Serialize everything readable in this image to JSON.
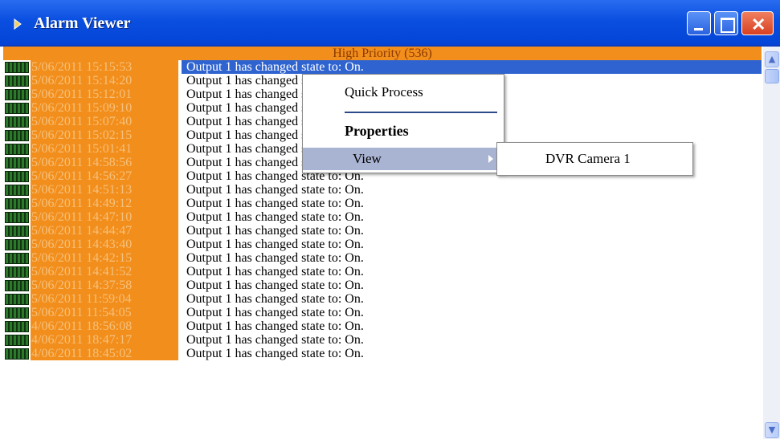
{
  "window": {
    "title": "Alarm Viewer",
    "buttons": {
      "minimize": "minimize",
      "maximize": "maximize",
      "close": "✕"
    }
  },
  "list": {
    "group_header": "High Priority (536)",
    "rows": [
      {
        "date": "5/06/2011  15:15:53",
        "message": "Output 1 has changed state to: On.",
        "selected": true
      },
      {
        "date": "5/06/2011  15:14:20",
        "message": "Output 1 has changed state to: On."
      },
      {
        "date": "5/06/2011  15:12:01",
        "message": "Output 1 has changed state to: On."
      },
      {
        "date": "5/06/2011  15:09:10",
        "message": "Output 1 has changed state to: On."
      },
      {
        "date": "5/06/2011  15:07:40",
        "message": "Output 1 has changed state to: On."
      },
      {
        "date": "5/06/2011  15:02:15",
        "message": "Output 1 has changed state to: On."
      },
      {
        "date": "5/06/2011  15:01:41",
        "message": "Output 1 has changed state to: On."
      },
      {
        "date": "5/06/2011  14:58:56",
        "message": "Output 1 has changed state to: On."
      },
      {
        "date": "5/06/2011  14:56:27",
        "message": "Output 1 has changed state to: On."
      },
      {
        "date": "5/06/2011  14:51:13",
        "message": "Output 1 has changed state to: On."
      },
      {
        "date": "5/06/2011  14:49:12",
        "message": "Output 1 has changed state to: On."
      },
      {
        "date": "5/06/2011  14:47:10",
        "message": "Output 1 has changed state to: On."
      },
      {
        "date": "5/06/2011  14:44:47",
        "message": "Output 1 has changed state to: On."
      },
      {
        "date": "5/06/2011  14:43:40",
        "message": "Output 1 has changed state to: On."
      },
      {
        "date": "5/06/2011  14:42:15",
        "message": "Output 1 has changed state to: On."
      },
      {
        "date": "5/06/2011  14:41:52",
        "message": "Output 1 has changed state to: On."
      },
      {
        "date": "5/06/2011  14:37:58",
        "message": "Output 1 has changed state to: On."
      },
      {
        "date": "5/06/2011  11:59:04",
        "message": "Output 1 has changed state to: On."
      },
      {
        "date": "5/06/2011  11:54:05",
        "message": "Output 1 has changed state to: On."
      },
      {
        "date": "4/06/2011  18:56:08",
        "message": "Output 1 has changed state to: On."
      },
      {
        "date": "4/06/2011  18:47:17",
        "message": "Output 1 has changed state to: On."
      },
      {
        "date": "4/06/2011  18:45:02",
        "message": "Output 1 has changed state to: On."
      }
    ]
  },
  "context_menu": {
    "items": [
      "Quick Process",
      "Properties",
      "View"
    ],
    "submenu": [
      "DVR Camera 1"
    ]
  },
  "colors": {
    "titlebar": "#0a4fe0",
    "priority_orange": "#f28e1c",
    "selection": "#2f64d0",
    "menu_highlight": "#a9b3d2"
  },
  "icons": [
    "alarm-viewer-icon",
    "alarm-row-icon",
    "submenu-arrow-icon",
    "scroll-up-icon",
    "scroll-down-icon"
  ]
}
